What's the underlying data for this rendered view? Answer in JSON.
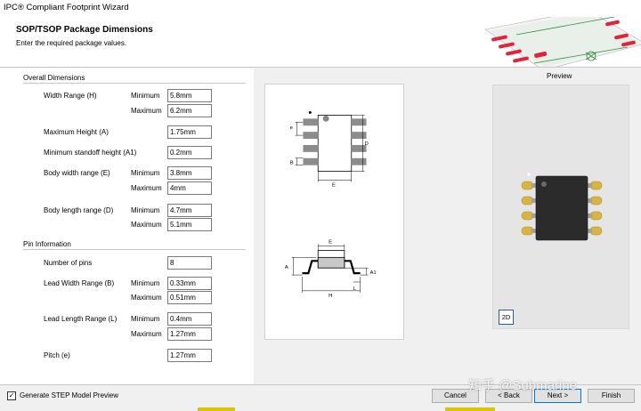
{
  "window": {
    "title": "IPC® Compliant Footprint Wizard"
  },
  "header": {
    "title": "SOP/TSOP Package Dimensions",
    "subtitle": "Enter the required package values."
  },
  "overall": {
    "section_title": "Overall Dimensions",
    "width_range": {
      "label": "Width Range (H)",
      "min_label": "Minimum",
      "min": "5.8mm",
      "max_label": "Maximum",
      "max": "6.2mm"
    },
    "max_height": {
      "label": "Maximum Height (A)",
      "value": "1.75mm"
    },
    "min_standoff": {
      "label": "Minimum standoff height (A1)",
      "value": "0.2mm"
    },
    "body_width": {
      "label": "Body width range (E)",
      "min_label": "Minimum",
      "min": "3.8mm",
      "max_label": "Maximum",
      "max": "4mm"
    },
    "body_length": {
      "label": "Body length range (D)",
      "min_label": "Minimum",
      "min": "4.7mm",
      "max_label": "Maximum",
      "max": "5.1mm"
    }
  },
  "pins": {
    "section_title": "Pin Information",
    "num_pins": {
      "label": "Number of pins",
      "value": "8"
    },
    "lead_width": {
      "label": "Lead Width Range (B)",
      "min_label": "Minimum",
      "min": "0.33mm",
      "max_label": "Maximum",
      "max": "0.51mm"
    },
    "lead_length": {
      "label": "Lead Length Range (L)",
      "min_label": "Minimum",
      "min": "0.4mm",
      "max_label": "Maximum",
      "max": "1.27mm"
    },
    "pitch": {
      "label": "Pitch (e)",
      "value": "1.27mm"
    }
  },
  "diagram": {
    "top_labels": {
      "e": "e",
      "b": "B",
      "d": "D",
      "ew": "E"
    },
    "side_labels": {
      "e": "E",
      "a": "A",
      "a1": "A1",
      "h": "H",
      "l": "L"
    }
  },
  "preview": {
    "label": "Preview",
    "mode_button": "2D"
  },
  "footer": {
    "step_checkbox_label": "Generate STEP Model Preview",
    "step_checked": true,
    "cancel": "Cancel",
    "back": "< Back",
    "next": "Next >",
    "finish": "Finish"
  },
  "watermark": "知乎 @Submarine",
  "colors": {
    "pad_gold": "#d8b443",
    "body_dark": "#2b2b2b",
    "preview_bg": "#e5e5e5",
    "pcb_red": "#e0243a",
    "pcb_green": "#2f8f3a"
  }
}
